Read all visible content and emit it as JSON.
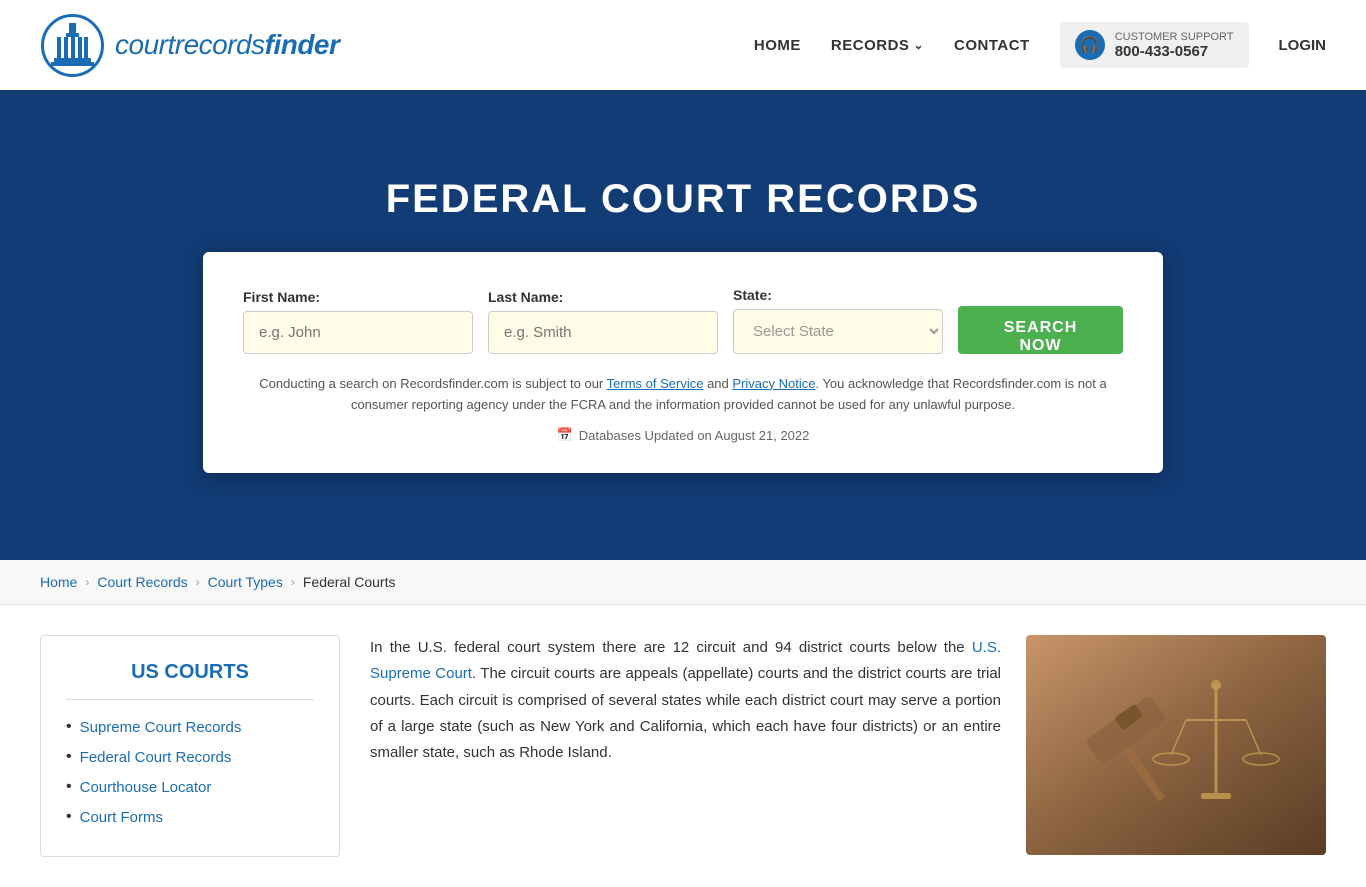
{
  "header": {
    "logo_text_regular": "courtrecords",
    "logo_text_bold": "finder",
    "nav": {
      "home": "HOME",
      "records": "RECORDS",
      "contact": "CONTACT",
      "login": "LOGIN"
    },
    "support": {
      "label": "CUSTOMER SUPPORT",
      "number": "800-433-0567"
    }
  },
  "hero": {
    "title": "FEDERAL COURT RECORDS",
    "search": {
      "first_name_label": "First Name:",
      "first_name_placeholder": "e.g. John",
      "last_name_label": "Last Name:",
      "last_name_placeholder": "e.g. Smith",
      "state_label": "State:",
      "state_default": "Select State",
      "search_button": "SEARCH NOW"
    },
    "disclaimer": "Conducting a search on Recordsfinder.com is subject to our Terms of Service and Privacy Notice. You acknowledge that Recordsfinder.com is not a consumer reporting agency under the FCRA and the information provided cannot be used for any unlawful purpose.",
    "db_update": "Databases Updated on August 21, 2022"
  },
  "breadcrumb": {
    "items": [
      {
        "label": "Home",
        "link": true
      },
      {
        "label": "Court Records",
        "link": true
      },
      {
        "label": "Court Types",
        "link": true
      },
      {
        "label": "Federal Courts",
        "link": false
      }
    ]
  },
  "sidebar": {
    "title": "US COURTS",
    "links": [
      {
        "label": "Supreme Court Records",
        "href": "#"
      },
      {
        "label": "Federal Court Records",
        "href": "#"
      },
      {
        "label": "Courthouse Locator",
        "href": "#"
      },
      {
        "label": "Court Forms",
        "href": "#"
      }
    ]
  },
  "main": {
    "paragraph": "In the U.S. federal court system there are 12 circuit and 94 district courts below the U.S. Supreme Court. The circuit courts are appeals (appellate) courts and the district courts are trial courts. Each circuit is comprised of several states while each district court may serve a portion of a large state (such as New York and California, which each have four districts) or an entire smaller state, such as Rhode Island.",
    "supreme_court_link": "U.S. Supreme Court"
  },
  "icons": {
    "headset": "🎧",
    "calendar": "📅",
    "chevron_right": "›",
    "chevron_down": "∨"
  }
}
